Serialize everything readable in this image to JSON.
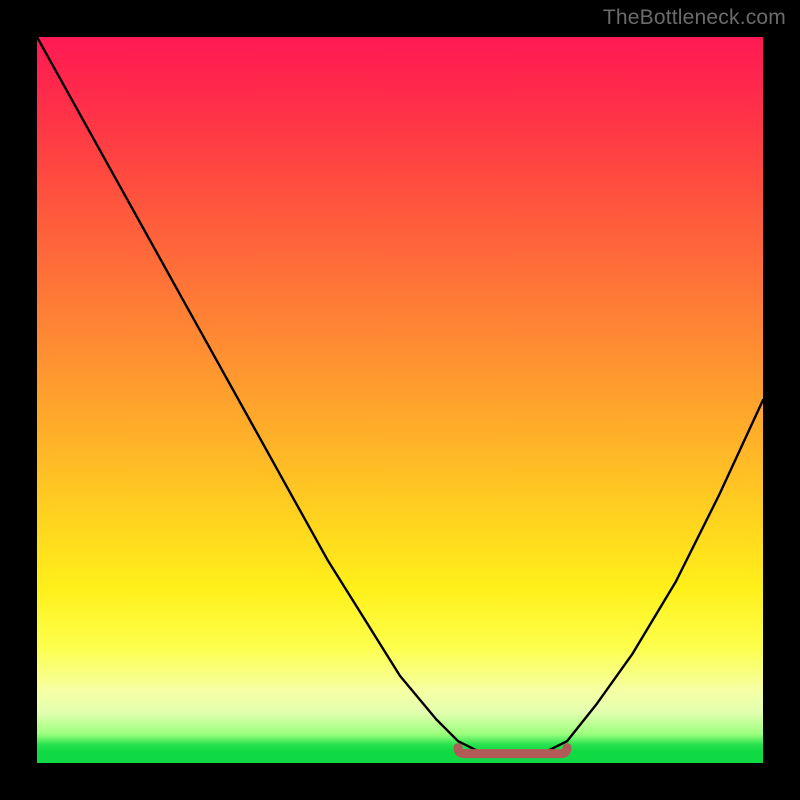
{
  "watermark": "TheBottleneck.com",
  "colors": {
    "frame": "#000000",
    "gradient_top": "#ff1a53",
    "gradient_mid": "#ffd21f",
    "gradient_bottom": "#0fd943",
    "curve": "#000000",
    "marker_stroke": "#b25a58",
    "marker_fill": "#d96e64"
  },
  "chart_data": {
    "type": "line",
    "title": "",
    "xlabel": "",
    "ylabel": "",
    "xlim": [
      0,
      100
    ],
    "ylim": [
      0,
      100
    ],
    "series": [
      {
        "name": "curve",
        "x": [
          0,
          5,
          10,
          15,
          20,
          25,
          30,
          35,
          40,
          45,
          50,
          55,
          58,
          61,
          64,
          67,
          70,
          73,
          77,
          82,
          88,
          94,
          100
        ],
        "y": [
          100,
          91,
          82,
          73,
          64,
          55,
          46,
          37,
          28,
          20,
          12,
          6,
          3,
          1.5,
          1.2,
          1.2,
          1.5,
          3,
          8,
          15,
          25,
          37,
          50
        ]
      }
    ],
    "flat_region": {
      "series": "curve",
      "x_start": 58,
      "x_end": 73,
      "y": 1.3,
      "note": "highlighted bottom segment"
    }
  }
}
